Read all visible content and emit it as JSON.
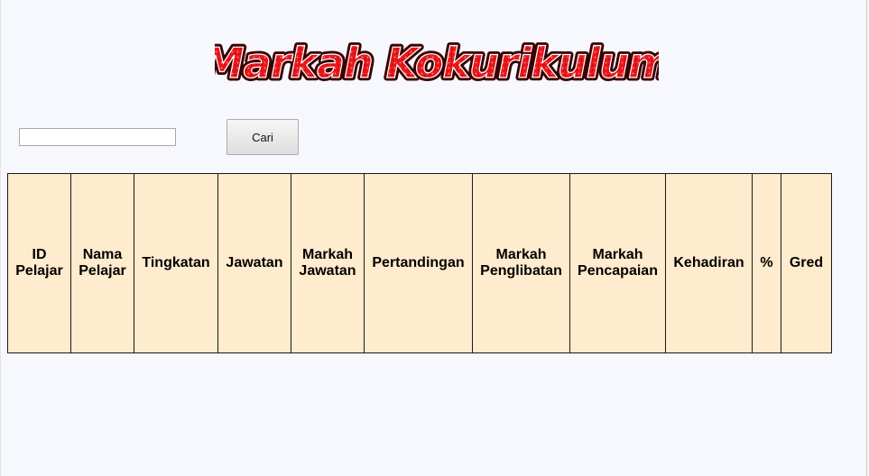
{
  "header": {
    "title": "Markah Kokurikulum"
  },
  "search": {
    "value": "",
    "placeholder": "",
    "button_label": "Cari"
  },
  "table": {
    "columns": [
      "ID\nPelajar",
      "Nama\nPelajar",
      "Tingkatan",
      "Jawatan",
      "Markah\nJawatan",
      "Pertandingan",
      "Markah\nPenglibatan",
      "Markah\nPencapaian",
      "Kehadiran",
      "%",
      "Gred"
    ],
    "rows": []
  },
  "colors": {
    "page_background": "#f7f8fd",
    "title_fill": "#e8171c",
    "title_outline": "#3a0000",
    "header_cell_background": "#ffebcd"
  }
}
